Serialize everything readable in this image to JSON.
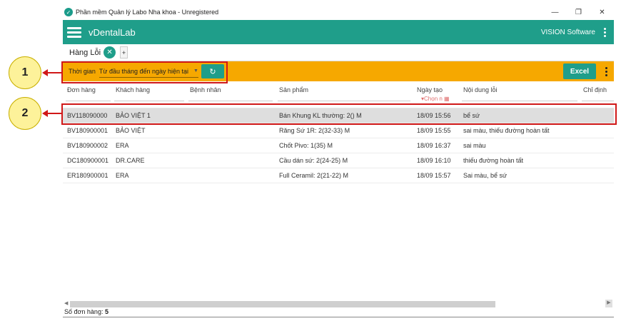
{
  "window": {
    "title": "Phần mềm Quản lý Labo Nha khoa - Unregistered",
    "controls": {
      "minimize": "—",
      "restore": "❐",
      "close": "✕"
    }
  },
  "appbar": {
    "app_name": "vDentalLab",
    "company": "VISION Software"
  },
  "tabs": [
    {
      "label": "Hàng Lỗi",
      "close": "✕"
    }
  ],
  "tab_add": "+",
  "filter": {
    "label": "Thời gian",
    "selected": "Từ đầu tháng đến ngày hiện tại",
    "refresh_icon": "↻",
    "excel_label": "Excel"
  },
  "table": {
    "columns": [
      "Đơn hàng",
      "Khách hàng",
      "Bệnh nhân",
      "Sản phẩm",
      "Ngày tạo",
      "Nội dung lỗi",
      "Chỉ định"
    ],
    "date_filter_placeholder": "Chọn n",
    "rows": [
      {
        "order": "BV118090000",
        "customer": "BẢO VIỆT 1",
        "patient": "",
        "product": "Bán Khung KL thường: 2() M",
        "created": "18/09 15:56",
        "error": "bể sứ",
        "note": ""
      },
      {
        "order": "BV180900001",
        "customer": "BẢO VIỆT",
        "patient": "",
        "product": "Răng Sứ 1R: 2(32-33) M",
        "created": "18/09 15:55",
        "error": "sai màu, thiếu đường hoàn  tất",
        "note": ""
      },
      {
        "order": "BV180900002",
        "customer": "ERA",
        "patient": "",
        "product": "Chốt Pivo: 1(35) M",
        "created": "18/09 16:37",
        "error": "sai màu",
        "note": ""
      },
      {
        "order": "DC180900001",
        "customer": "DR.CARE",
        "patient": "",
        "product": "Cầu dán sứ: 2(24-25) M",
        "created": "18/09 16:10",
        "error": "thiếu đường hoàn tất",
        "note": ""
      },
      {
        "order": "ER180900001",
        "customer": "ERA",
        "patient": "",
        "product": "Full Ceramil: 2(21-22) M",
        "created": "18/09 15:57",
        "error": "Sai màu, bể sứ",
        "note": ""
      }
    ]
  },
  "status": {
    "label": "Số đơn hàng:",
    "count": "5"
  },
  "callouts": {
    "one": "1",
    "two": "2"
  },
  "colors": {
    "primary": "#1f9e8a",
    "toolbar": "#f6a800",
    "highlight": "#d01818"
  }
}
